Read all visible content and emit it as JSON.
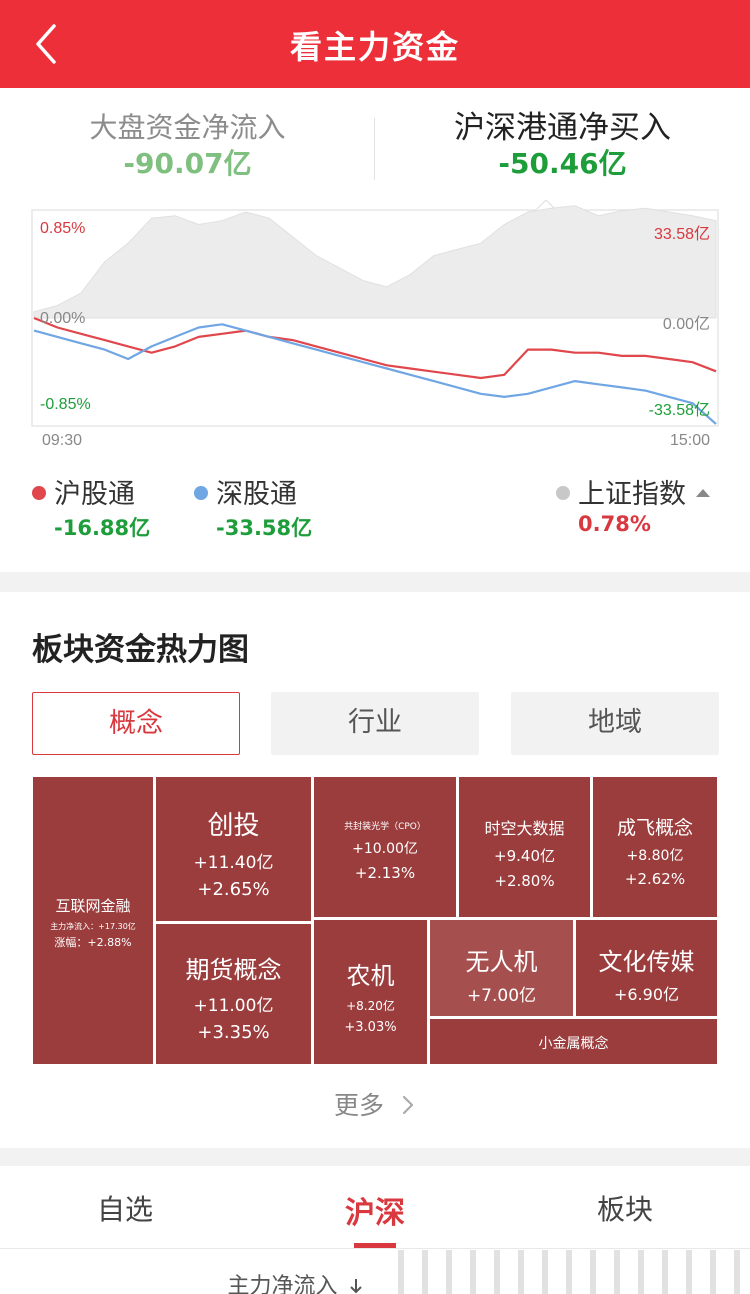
{
  "header": {
    "title": "看主力资金",
    "back_icon": "chevron-left-icon"
  },
  "summary": {
    "left": {
      "label": "大盘资金净流入",
      "value": "-90.07亿"
    },
    "right": {
      "label": "沪深港通净买入",
      "value": "-50.46亿"
    }
  },
  "chart_data": {
    "type": "line",
    "x_start_label": "09:30",
    "x_end_label": "15:00",
    "y_left_ticks": [
      "0.85%",
      "0.00%",
      "-0.85%"
    ],
    "y_right_ticks": [
      "33.58亿",
      "0.00亿",
      "-33.58亿"
    ],
    "ylim_left": [
      -0.85,
      0.85
    ],
    "ylim_right": [
      -33.58,
      33.58
    ],
    "grid": false,
    "series": [
      {
        "name": "沪股通",
        "color": "#e0474c",
        "axis": "right",
        "values": [
          0,
          -3,
          -5,
          -7,
          -9,
          -11,
          -9,
          -6,
          -5,
          -4,
          -6,
          -7,
          -9,
          -11,
          -13,
          -15,
          -16,
          -17,
          -18,
          -19,
          -18,
          -10,
          -10,
          -11,
          -11,
          -12,
          -12,
          -13,
          -14,
          -16.88
        ]
      },
      {
        "name": "深股通",
        "color": "#6fa6e3",
        "axis": "right",
        "values": [
          -4,
          -6,
          -8,
          -10,
          -13,
          -9,
          -6,
          -3,
          -2,
          -4,
          -6,
          -8,
          -10,
          -12,
          -14,
          -16,
          -18,
          -20,
          -22,
          -24,
          -25,
          -24,
          -22,
          -20,
          -21,
          -22,
          -23,
          -25,
          -27,
          -33.58
        ]
      },
      {
        "name": "上证指数",
        "color": "#c8c8c8",
        "axis": "left",
        "fill": true,
        "values": [
          0.05,
          0.1,
          0.2,
          0.45,
          0.6,
          0.8,
          0.82,
          0.75,
          0.78,
          0.85,
          0.8,
          0.65,
          0.5,
          0.4,
          0.3,
          0.25,
          0.35,
          0.5,
          0.55,
          0.6,
          0.75,
          0.85,
          0.88,
          0.9,
          0.82,
          0.86,
          0.88,
          0.85,
          0.82,
          0.78
        ]
      }
    ]
  },
  "legend": {
    "sh": {
      "name": "沪股通",
      "value": "-16.88亿",
      "color": "#e0474c"
    },
    "sz": {
      "name": "深股通",
      "value": "-33.58亿",
      "color": "#6fa6e3"
    },
    "index": {
      "name": "上证指数",
      "value": "0.78%",
      "color": "#c8c8c8",
      "caret_icon": "caret-up-icon"
    }
  },
  "heatmap": {
    "title": "板块资金热力图",
    "tabs": [
      "概念",
      "行业",
      "地域"
    ],
    "active_tab": "概念",
    "tiles": [
      {
        "name": "互联网金融",
        "line1": "主力净流入：+17.30亿",
        "line2": "涨幅：+2.88%"
      },
      {
        "name": "创投",
        "line1": "+11.40亿",
        "line2": "+2.65%"
      },
      {
        "name": "共封装光学（CPO）",
        "line1": "+10.00亿",
        "line2": "+2.13%"
      },
      {
        "name": "时空大数据",
        "line1": "+9.40亿",
        "line2": "+2.80%"
      },
      {
        "name": "成飞概念",
        "line1": "+8.80亿",
        "line2": "+2.62%"
      },
      {
        "name": "期货概念",
        "line1": "+11.00亿",
        "line2": "+3.35%"
      },
      {
        "name": "农机",
        "line1": "+8.20亿",
        "line2": "+3.03%"
      },
      {
        "name": "无人机",
        "line1": "+7.00亿",
        "line2": ""
      },
      {
        "name": "文化传媒",
        "line1": "+6.90亿",
        "line2": ""
      },
      {
        "name": "小金属概念",
        "line1": "",
        "line2": ""
      }
    ],
    "more_label": "更多",
    "more_icon": "chevron-right-icon"
  },
  "bottom_tabs": [
    "自选",
    "沪深",
    "板块"
  ],
  "bottom_active": "沪深",
  "sort_label": "主力净流入",
  "sort_icon": "arrow-down-icon"
}
